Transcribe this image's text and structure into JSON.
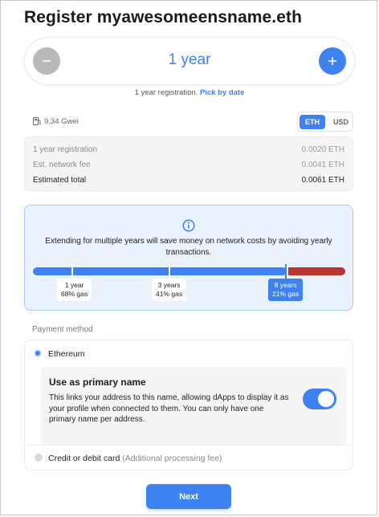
{
  "title": "Register myawesomeensname.eth",
  "duration": {
    "value": "1 year",
    "subline_text": "1 year registration.",
    "subline_link": "Pick by date"
  },
  "gas": {
    "price": "9.34 Gwei",
    "currency_options": [
      "ETH",
      "USD"
    ],
    "selected_currency": "ETH"
  },
  "fees": [
    {
      "label": "1 year registration",
      "value": "0.0020 ETH"
    },
    {
      "label": "Est. network fee",
      "value": "0.0041 ETH"
    },
    {
      "label": "Estimated total",
      "value": "0.0061 ETH"
    }
  ],
  "info": {
    "text": "Extending for multiple years will save money on network costs by avoiding yearly transactions.",
    "markers": [
      {
        "years": "1 year",
        "gas": "68% gas"
      },
      {
        "years": "3 years",
        "gas": "41% gas"
      },
      {
        "years": "8 years",
        "gas": "21% gas"
      }
    ]
  },
  "payment": {
    "label": "Payment method",
    "ethereum_label": "Ethereum",
    "primary_title": "Use as primary name",
    "primary_desc": "This links your address to this name, allowing dApps to display it as your profile when connected to them. You can only have one primary name per address.",
    "primary_enabled": true,
    "card_label": "Credit or debit card",
    "card_extra": "(Additional processing fee)"
  },
  "next_label": "Next",
  "colors": {
    "accent": "#3d82f0",
    "warning": "#b5372f"
  }
}
